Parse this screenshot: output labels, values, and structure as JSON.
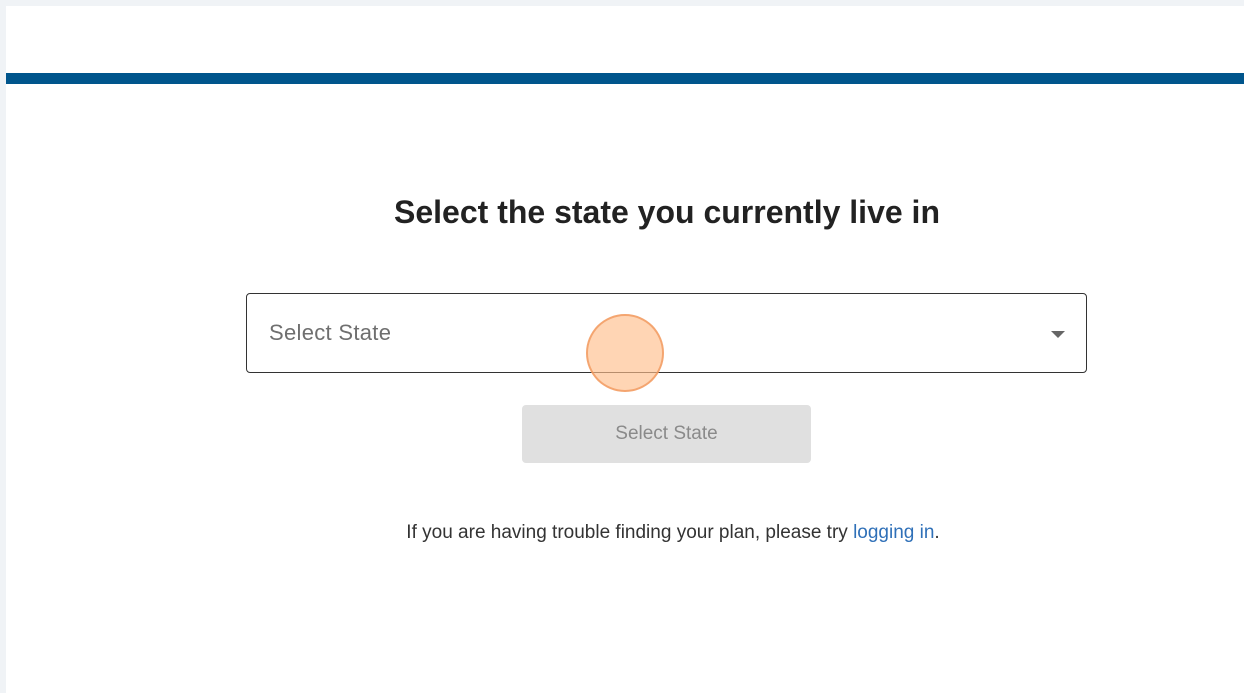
{
  "theme": {
    "brand_color": "#00558c",
    "link_color": "#2f70b8",
    "button_disabled_bg": "#e0e0e0"
  },
  "main": {
    "heading": "Select the state you currently live in",
    "state_select": {
      "placeholder": "Select State",
      "icon": "caret-down-icon"
    },
    "submit_button": {
      "label": "Select State",
      "disabled": true
    },
    "help": {
      "text_before": "If you are having trouble finding your plan, please try ",
      "link_text": "logging in",
      "text_after": "."
    }
  }
}
